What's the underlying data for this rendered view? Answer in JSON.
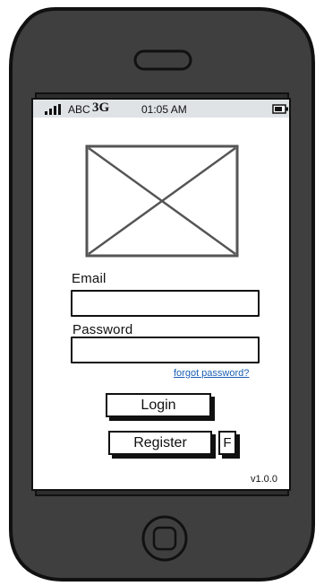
{
  "status_bar": {
    "carrier": "ABC",
    "network": "3G",
    "time": "01:05 AM"
  },
  "form": {
    "email_label": "Email",
    "email_value": "",
    "password_label": "Password",
    "password_value": "",
    "forgot_password": "forgot password?",
    "login_button": "Login",
    "register_button": "Register",
    "facebook_button": "F"
  },
  "footer": {
    "version": "v1.0.0"
  },
  "colors": {
    "device_body": "#3f3f3f",
    "device_outline": "#111111",
    "status_bar_bg": "#dfe3e6",
    "link": "#1a5fb4"
  },
  "icons": {
    "signal": "signal-bars-icon",
    "battery": "battery-icon",
    "image_placeholder": "image-placeholder-icon",
    "speaker": "speaker-icon",
    "home_button": "home-button-icon"
  }
}
